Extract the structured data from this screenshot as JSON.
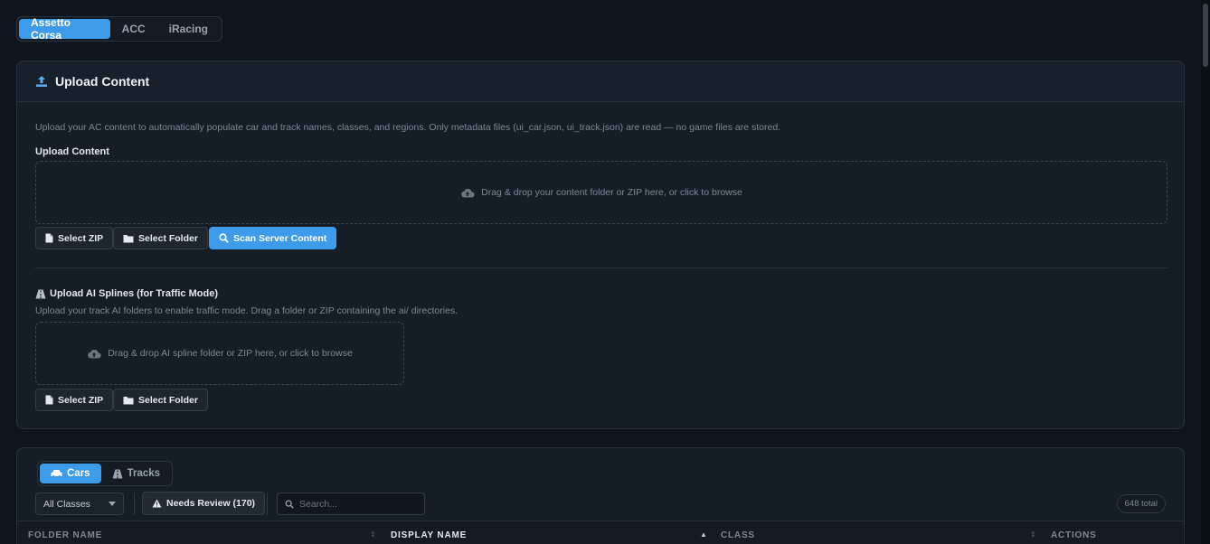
{
  "game_tabs": [
    "Assetto Corsa",
    "ACC",
    "iRacing"
  ],
  "upload_card": {
    "title": "Upload Content",
    "description": "Upload your AC content to automatically populate car and track names, classes, and regions. Only metadata files (ui_car.json, ui_track.json) are read — no game files are stored.",
    "content_label": "Upload Content",
    "content_dropzone_text": "Drag & drop your content folder or ZIP here, or click to browse",
    "select_zip": "Select ZIP",
    "select_folder": "Select Folder",
    "scan_server": "Scan Server Content",
    "ai_label": "Upload AI Splines (for Traffic Mode)",
    "ai_description": "Upload your track AI folders to enable traffic mode. Drag a folder or ZIP containing the ai/ directories.",
    "ai_dropzone_text": "Drag & drop AI spline folder or ZIP here, or click to browse",
    "ai_select_zip": "Select ZIP",
    "ai_select_folder": "Select Folder"
  },
  "list_card": {
    "tabs": [
      "Cars",
      "Tracks"
    ],
    "class_filter": "All Classes",
    "needs_review": "Needs Review (170)",
    "search_placeholder": "Search...",
    "total": "648 total",
    "columns": [
      "FOLDER NAME",
      "DISPLAY NAME",
      "CLASS",
      "ACTIONS"
    ]
  },
  "colors": {
    "accent": "#3d9be9",
    "background": "#0f151d",
    "card": "#151d26"
  }
}
